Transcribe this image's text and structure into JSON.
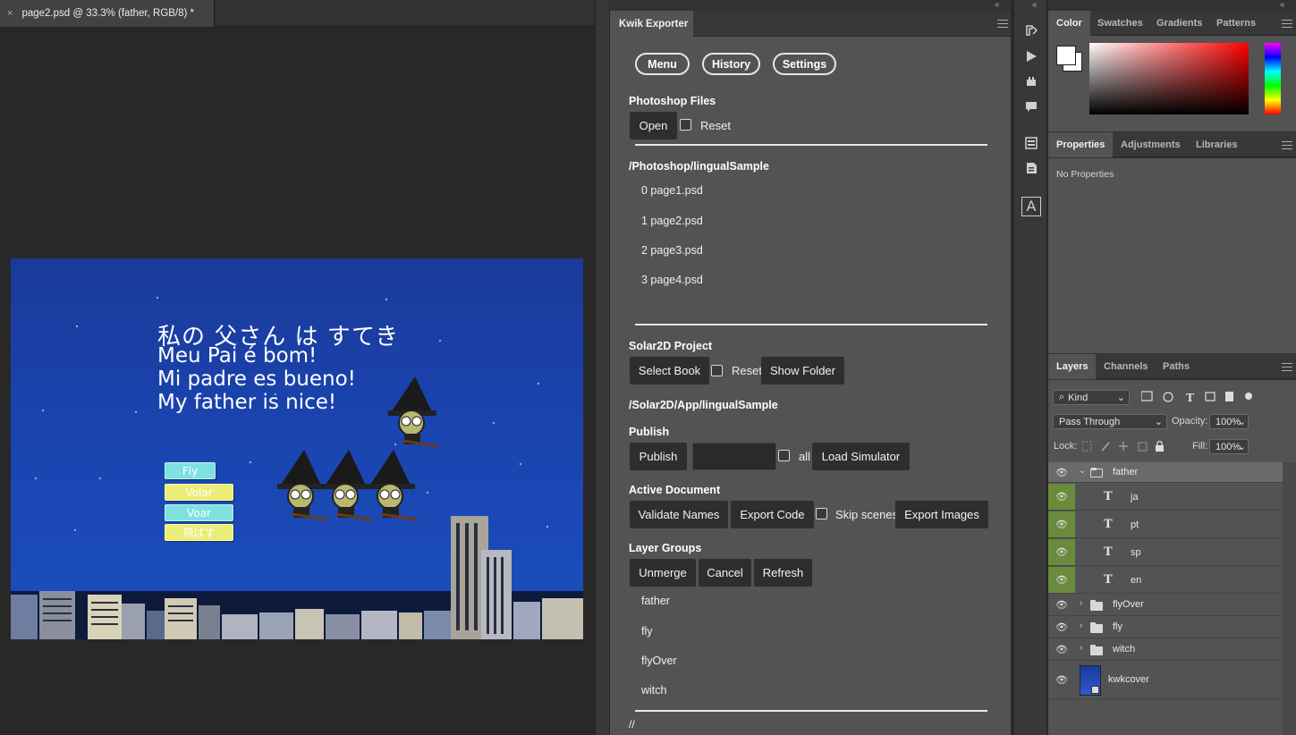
{
  "document": {
    "tab_title": "page2.psd @ 33.3% (father, RGB/8) *",
    "close_glyph": "×",
    "artwork": {
      "line_ja": "私の 父さん は すてき",
      "line_pt": "Meu Pai é bom!",
      "line_sp": "Mi padre es bueno!",
      "line_en": "My father is nice!",
      "buttons": [
        "Fly",
        "Volar",
        "Voar",
        "飛ばす"
      ]
    }
  },
  "kwik": {
    "tab_label": "Kwik Exporter",
    "nav": [
      "Menu",
      "History",
      "Settings"
    ],
    "photoshop_files": {
      "title": "Photoshop Files",
      "open_label": "Open",
      "reset_label": "Reset"
    },
    "ps_path": "/Photoshop/lingualSample",
    "ps_files": [
      "0 page1.psd",
      "1 page2.psd",
      "2 page3.psd",
      "3 page4.psd"
    ],
    "solar": {
      "title": "Solar2D Project",
      "select_book": "Select Book",
      "reset_label": "Reset",
      "show_folder": "Show Folder"
    },
    "solar_path": "/Solar2D/App/lingualSample",
    "publish": {
      "title": "Publish",
      "publish_label": "Publish",
      "input_value": "",
      "all_label": "all",
      "load_simulator": "Load Simulator"
    },
    "active_document": {
      "title": "Active Document",
      "validate": "Validate Names",
      "export_code": "Export Code",
      "skip_scenes": "Skip scenes",
      "export_images": "Export Images"
    },
    "layer_groups": {
      "title": "Layer Groups",
      "unmerge": "Unmerge",
      "cancel": "Cancel",
      "refresh": "Refresh",
      "items": [
        "father",
        "fly",
        "flyOver",
        "witch"
      ]
    },
    "footer_path": "//"
  },
  "color_panel": {
    "tabs": [
      "Color",
      "Swatches",
      "Gradients",
      "Patterns"
    ],
    "foreground": "#ffffff",
    "background": "#ffffff",
    "hue": "#ff0000"
  },
  "properties_panel": {
    "tabs": [
      "Properties",
      "Adjustments",
      "Libraries"
    ],
    "empty_text": "No Properties"
  },
  "layers_panel": {
    "tabs": [
      "Layers",
      "Channels",
      "Paths"
    ],
    "filter_kind": "Kind",
    "blend_mode": "Pass Through",
    "opacity_label": "Opacity:",
    "opacity_value": "100%",
    "lock_label": "Lock:",
    "fill_label": "Fill:",
    "fill_value": "100%",
    "layers": [
      {
        "name": "father",
        "type": "group-open"
      },
      {
        "name": "ja",
        "type": "text"
      },
      {
        "name": "pt",
        "type": "text"
      },
      {
        "name": "sp",
        "type": "text"
      },
      {
        "name": "en",
        "type": "text"
      },
      {
        "name": "flyOver",
        "type": "group"
      },
      {
        "name": "fly",
        "type": "group"
      },
      {
        "name": "witch",
        "type": "group"
      },
      {
        "name": "kwkcover",
        "type": "smart-object"
      }
    ]
  },
  "icons": {
    "eye": "eye-icon",
    "text_layer": "T",
    "collapse": "«",
    "chev_right": "›",
    "chev_down": "⌄"
  }
}
